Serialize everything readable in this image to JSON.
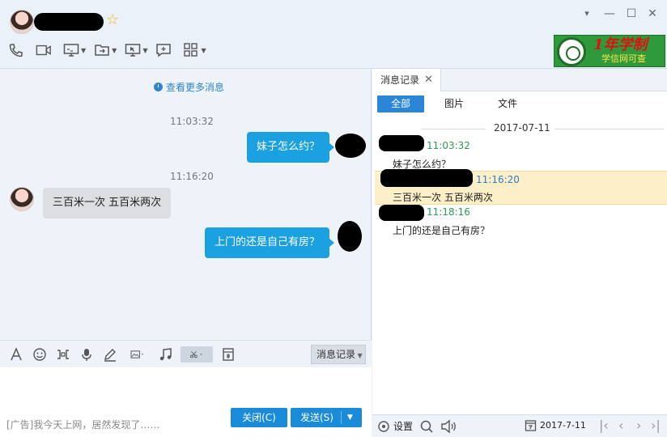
{
  "header": {
    "avatar_icon": "avatar-icon",
    "star_icon": "star-icon"
  },
  "window": {
    "dropdown": "▾",
    "minimize": "—",
    "maximize": "☐",
    "close": "✕"
  },
  "toolbar": {
    "items": [
      "phone-icon",
      "video-icon",
      "screen-share-icon",
      "file-transfer-icon",
      "remote-assist-icon",
      "message-icon",
      "apps-grid-icon"
    ]
  },
  "ad_banner": {
    "title": "1年学制",
    "subtitle": "学信网可查"
  },
  "chat": {
    "more_messages": "查看更多消息",
    "messages": [
      {
        "time": "11:03:32",
        "text": "妹子怎么约？",
        "direction": "out"
      },
      {
        "time": "11:16:20",
        "text": "三百米一次  五百米两次",
        "direction": "in"
      },
      {
        "time": "",
        "text": "上门的还是自己有房？",
        "direction": "out"
      }
    ]
  },
  "compose": {
    "history_button": "消息记录",
    "ad_text": "[广告]我今天上网，居然发现了……",
    "close_button": "关闭(C)",
    "send_button": "发送(S)"
  },
  "history_panel": {
    "tab_label": "消息记录",
    "filters": [
      "全部",
      "图片",
      "文件"
    ],
    "date": "2017-07-11",
    "records": [
      {
        "time": "11:03:32",
        "text": "妹子怎么约？",
        "time_color": "#2e9b54"
      },
      {
        "time": "11:16:20",
        "text": "三百米一次  五百米两次",
        "time_color": "#2a7fc7"
      },
      {
        "time": "11:18:16",
        "text": "上门的还是自己有房？",
        "time_color": "#2e9b54"
      }
    ],
    "footer": {
      "settings": "设置",
      "date": "2017-7-11"
    }
  }
}
